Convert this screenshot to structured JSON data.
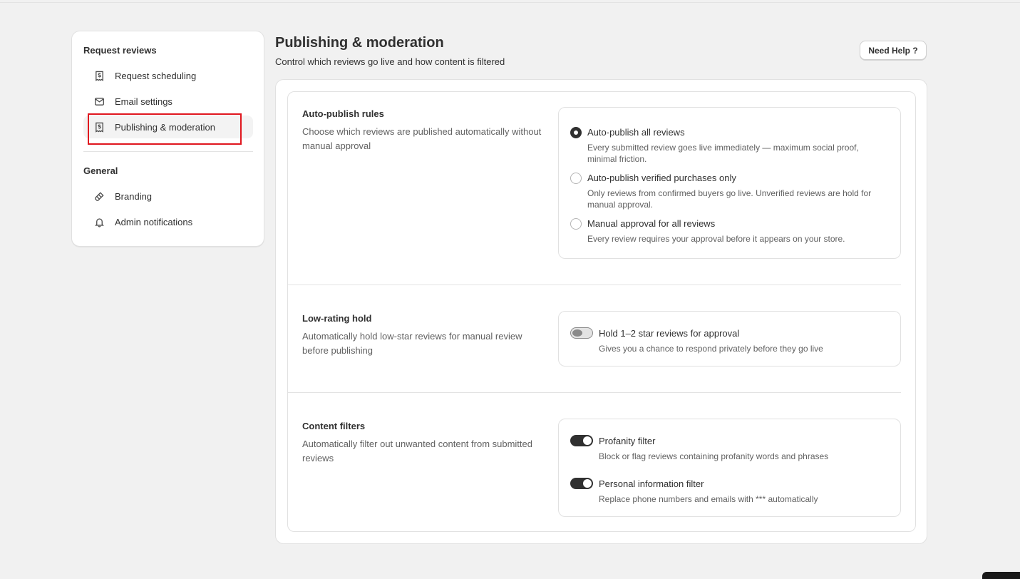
{
  "sidebar": {
    "request_group_title": "Request reviews",
    "request_items": [
      {
        "label": "Request scheduling",
        "icon": "receipt-dollar-icon"
      },
      {
        "label": "Email settings",
        "icon": "email-icon"
      },
      {
        "label": "Publishing & moderation",
        "icon": "receipt-dollar-icon",
        "active": true
      }
    ],
    "general_group_title": "General",
    "general_items": [
      {
        "label": "Branding",
        "icon": "paint-brush-icon"
      },
      {
        "label": "Admin notifications",
        "icon": "bell-icon"
      }
    ]
  },
  "header": {
    "title": "Publishing & moderation",
    "subtitle": "Control which reviews go live and how content is filtered",
    "help_label": "Need Help ?"
  },
  "sections": {
    "auto_publish": {
      "title": "Auto-publish rules",
      "description": "Choose which reviews are published automatically without manual approval",
      "options": [
        {
          "label": "Auto-publish all reviews",
          "help": "Every submitted review goes live immediately — maximum social proof, minimal friction.",
          "checked": true
        },
        {
          "label": "Auto-publish verified purchases only",
          "help": "Only reviews from confirmed buyers go live. Unverified reviews are hold for manual approval.",
          "checked": false
        },
        {
          "label": "Manual approval for all reviews",
          "help": "Every review requires your approval before it appears on your store.",
          "checked": false
        }
      ]
    },
    "low_rating": {
      "title": "Low-rating hold",
      "description": "Automatically hold low-star reviews for manual review before publishing",
      "toggle": {
        "label": "Hold 1–2 star reviews for approval",
        "help": "Gives you a chance to respond privately before they go live",
        "on": false
      }
    },
    "content_filters": {
      "title": "Content filters",
      "description": "Automatically filter out unwanted content from submitted reviews",
      "toggles": [
        {
          "label": "Profanity filter",
          "help": "Block or flag reviews containing profanity words and phrases",
          "on": true
        },
        {
          "label": "Personal information filter",
          "help": "Replace phone numbers and emails with *** automatically",
          "on": true
        }
      ]
    }
  },
  "colors": {
    "highlight": "#e0161e",
    "toggle_on": "#303030",
    "background": "#f1f1f1"
  }
}
